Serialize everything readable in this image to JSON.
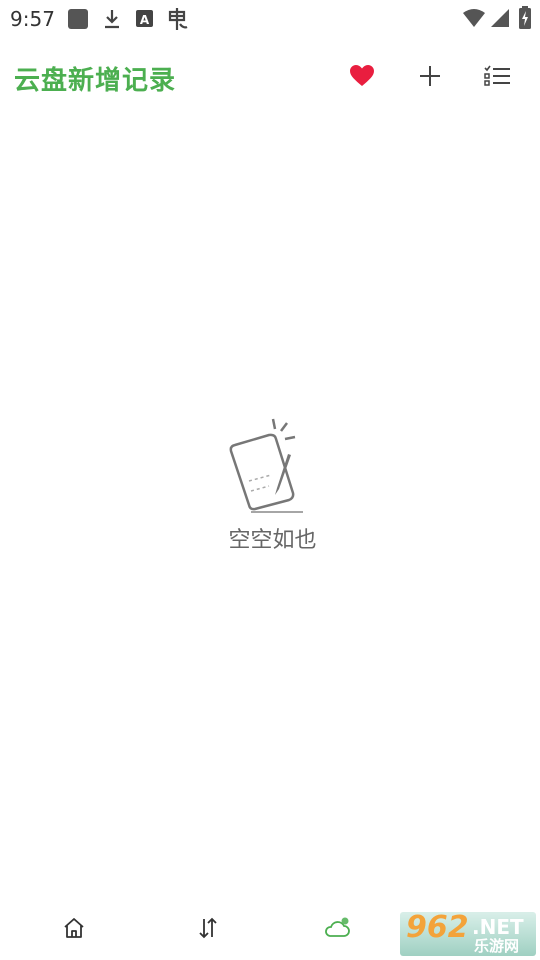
{
  "status_bar": {
    "time": "9:57",
    "icons": [
      "app-square-icon",
      "download-icon",
      "font-a-icon",
      "input-method-icon",
      "wifi-icon",
      "signal-icon",
      "battery-charging-icon"
    ]
  },
  "header": {
    "title": "云盘新增记录",
    "actions": [
      "heart-icon",
      "plus-icon",
      "checklist-icon"
    ]
  },
  "empty_state": {
    "icon": "empty-notes-icon",
    "text": "空空如也"
  },
  "bottom_nav": {
    "items": [
      "home-icon",
      "sort-arrows-icon",
      "cloud-icon"
    ],
    "active": "cloud-icon"
  },
  "watermark": {
    "number": "962",
    "domain": ".NET",
    "site_name": "乐游网"
  },
  "colors": {
    "accent_green": "#4caf50",
    "heart_red": "#e91e3f",
    "icon_gray": "#333333",
    "empty_text": "#666666"
  }
}
